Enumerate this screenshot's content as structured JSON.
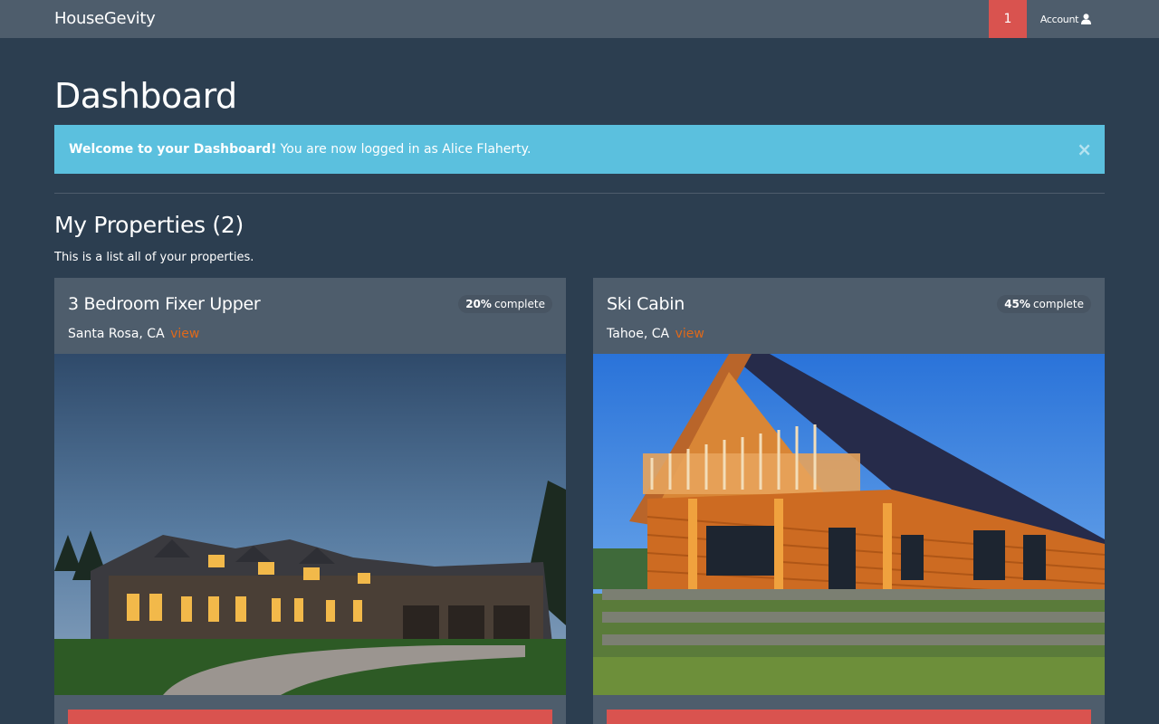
{
  "navbar": {
    "brand": "HouseGevity",
    "notification_count": "1",
    "account_label": "Account"
  },
  "page": {
    "title": "Dashboard"
  },
  "alert": {
    "strong": "Welcome to your Dashboard!",
    "text": "You are now logged in as Alice Flaherty.",
    "close": "×"
  },
  "properties": {
    "heading": "My Properties (2)",
    "subtitle": "This is a list all of your properties.",
    "items": [
      {
        "title": "3 Bedroom Fixer Upper",
        "percent": "20%",
        "complete_label": "complete",
        "location": "Santa Rosa, CA",
        "view_label": "view"
      },
      {
        "title": "Ski Cabin",
        "percent": "45%",
        "complete_label": "complete",
        "location": "Tahoe, CA",
        "view_label": "view"
      }
    ]
  },
  "colors": {
    "background": "#2c3e50",
    "navbar": "#4e5d6c",
    "danger": "#d9534f",
    "info": "#5bc0de",
    "link": "#df691a"
  },
  "icons": {
    "account": "user-icon",
    "alert_close": "close-icon"
  }
}
